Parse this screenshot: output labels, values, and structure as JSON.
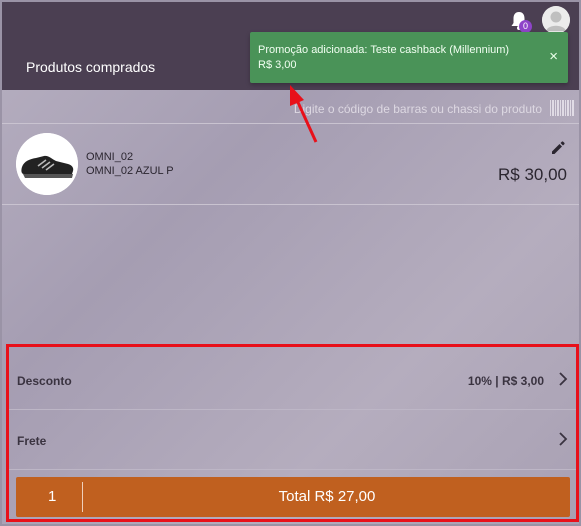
{
  "header": {
    "title": "Produtos comprados",
    "notification_count": "0",
    "notification_icon": "bell-icon",
    "avatar_icon": "user-avatar-icon"
  },
  "toast": {
    "message_line1": "Promoção adicionada: Teste cashback (Millennium)",
    "message_line2": "R$ 3,00",
    "close_label": "×",
    "color": "#4a9358"
  },
  "barcode": {
    "placeholder": "Digite o código de barras ou chassi do produto",
    "icon": "barcode-icon"
  },
  "product": {
    "name": "OMNI_02",
    "variant": "OMNI_02 AZUL P",
    "price": "R$ 30,00",
    "image_icon": "sneaker-image",
    "edit_icon": "pencil-icon"
  },
  "summary": {
    "discount_label": "Desconto",
    "discount_value": "10% | R$ 3,00",
    "shipping_label": "Frete",
    "shipping_value": "",
    "quantity": "1",
    "total_label": "Total R$ 27,00",
    "total_color": "#c0601f",
    "highlight_color": "#e8101a"
  }
}
